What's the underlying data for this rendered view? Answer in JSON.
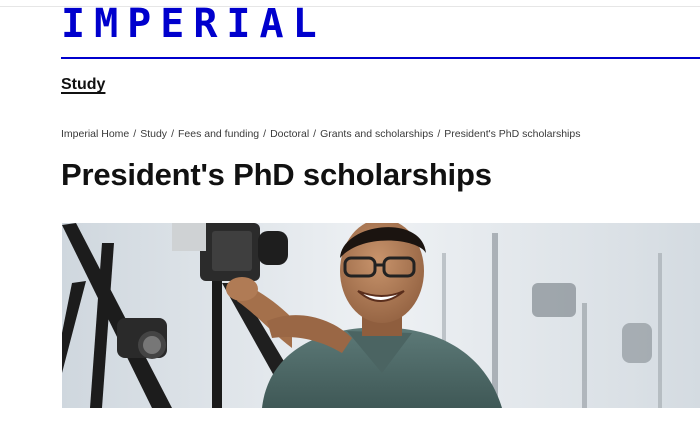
{
  "header": {
    "logo_text": "IMPERIAL",
    "section_link": "Study"
  },
  "breadcrumb": {
    "items": [
      "Imperial Home",
      "Study",
      "Fees and funding",
      "Doctoral",
      "Grants and scholarships",
      "President's PhD scholarships"
    ],
    "separator": "/"
  },
  "main": {
    "title": "President's PhD scholarships",
    "hero_image": "photo of smiling researcher adjusting camera equipment in a lab"
  },
  "colors": {
    "brand": "#0000cd",
    "text": "#111111",
    "muted": "#3a3a3a"
  }
}
